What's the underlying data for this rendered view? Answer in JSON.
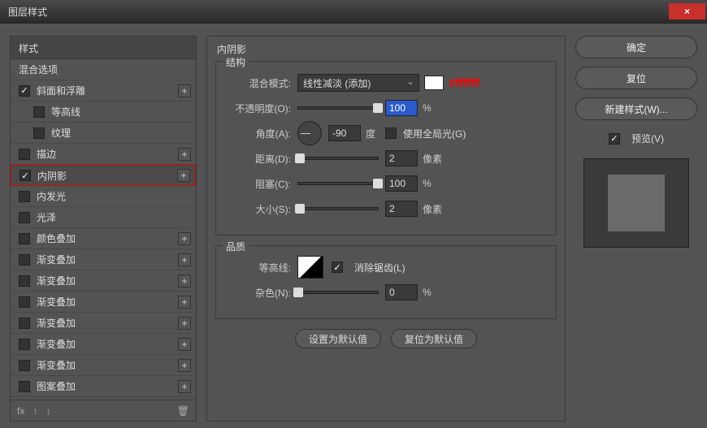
{
  "window": {
    "title": "图层样式",
    "close": "×"
  },
  "styles": {
    "header": "样式",
    "blending_options": "混合选项",
    "items": [
      {
        "label": "斜面和浮雕",
        "checked": true,
        "add": true
      },
      {
        "label": "等高线",
        "checked": false,
        "sub": true
      },
      {
        "label": "纹理",
        "checked": false,
        "sub": true
      },
      {
        "label": "描边",
        "checked": false,
        "add": true
      },
      {
        "label": "内阴影",
        "checked": true,
        "add": true,
        "selected": true
      },
      {
        "label": "内发光",
        "checked": false
      },
      {
        "label": "光泽",
        "checked": false
      },
      {
        "label": "颜色叠加",
        "checked": false,
        "add": true
      },
      {
        "label": "渐变叠加",
        "checked": false,
        "add": true
      },
      {
        "label": "渐变叠加",
        "checked": false,
        "add": true
      },
      {
        "label": "渐变叠加",
        "checked": false,
        "add": true
      },
      {
        "label": "渐变叠加",
        "checked": false,
        "add": true
      },
      {
        "label": "渐变叠加",
        "checked": false,
        "add": true
      },
      {
        "label": "渐变叠加",
        "checked": false,
        "add": true
      },
      {
        "label": "图案叠加",
        "checked": false,
        "add": true
      }
    ],
    "footer": {
      "fx": "fx",
      "up": "↑",
      "down": "↓",
      "trash": "🗑"
    }
  },
  "center": {
    "title": "内阴影",
    "structure": {
      "legend": "结构",
      "blend_mode_label": "混合模式:",
      "blend_mode_value": "线性减淡 (添加)",
      "hex_note": "#ffffff",
      "opacity_label": "不透明度(O):",
      "opacity_value": "100",
      "opacity_unit": "%",
      "angle_label": "角度(A):",
      "angle_value": "-90",
      "angle_unit": "度",
      "global_light": "使用全局光(G)",
      "distance_label": "距离(D):",
      "distance_value": "2",
      "distance_unit": "像素",
      "choke_label": "阻塞(C):",
      "choke_value": "100",
      "choke_unit": "%",
      "size_label": "大小(S):",
      "size_value": "2",
      "size_unit": "像素"
    },
    "quality": {
      "legend": "品质",
      "contour_label": "等高线:",
      "antialias": "消除锯齿(L)",
      "noise_label": "杂色(N):",
      "noise_value": "0",
      "noise_unit": "%"
    },
    "buttons": {
      "default": "设置为默认值",
      "reset": "复位为默认值"
    }
  },
  "right": {
    "ok": "确定",
    "cancel": "复位",
    "new_style": "新建样式(W)...",
    "preview": "预览(V)"
  }
}
